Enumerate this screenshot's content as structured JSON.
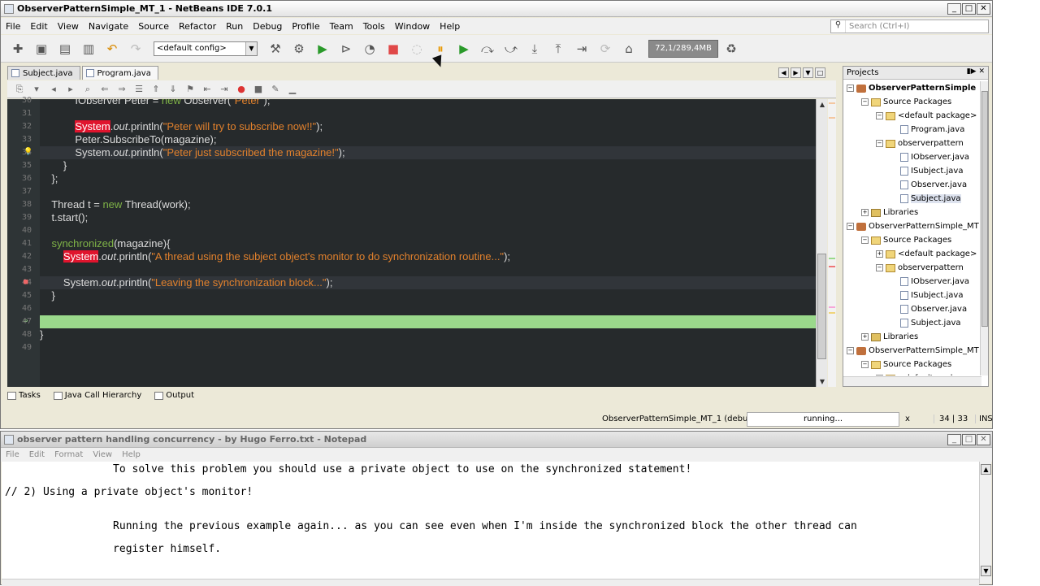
{
  "netbeans": {
    "title": "ObserverPatternSimple_MT_1 - NetBeans IDE 7.0.1",
    "menu": [
      "File",
      "Edit",
      "View",
      "Navigate",
      "Source",
      "Refactor",
      "Run",
      "Debug",
      "Profile",
      "Team",
      "Tools",
      "Window",
      "Help"
    ],
    "search_placeholder": "Search (Ctrl+I)",
    "config": "<default config>",
    "memory": "72,1/289,4MB",
    "tabs": [
      "Subject.java",
      "Program.java"
    ],
    "code_lines": [
      {
        "n": "30",
        "parts": [
          {
            "t": "            IObserver Peter = "
          },
          {
            "t": "new",
            "c": "kw"
          },
          {
            "t": " Observer("
          },
          {
            "t": "\"Peter\"",
            "c": "str"
          },
          {
            "t": ");"
          }
        ]
      },
      {
        "n": "31",
        "parts": []
      },
      {
        "n": "32",
        "parts": [
          {
            "t": "            "
          },
          {
            "t": "System",
            "c": "err"
          },
          {
            "t": "."
          },
          {
            "t": "out",
            "c": "it"
          },
          {
            "t": ".println("
          },
          {
            "t": "\"Peter will try to subscribe now!!\"",
            "c": "str"
          },
          {
            "t": ");"
          }
        ]
      },
      {
        "n": "33",
        "parts": [
          {
            "t": "            Peter.SubscribeTo(magazine);"
          }
        ]
      },
      {
        "n": "34",
        "parts": [
          {
            "t": "            System."
          },
          {
            "t": "out",
            "c": "it"
          },
          {
            "t": ".println("
          },
          {
            "t": "\"Peter just subscribed the magazine!\"",
            "c": "str"
          },
          {
            "t": ");"
          }
        ]
      },
      {
        "n": "35",
        "parts": [
          {
            "t": "        }"
          }
        ]
      },
      {
        "n": "36",
        "parts": [
          {
            "t": "    };"
          }
        ]
      },
      {
        "n": "37",
        "parts": []
      },
      {
        "n": "38",
        "parts": [
          {
            "t": "    Thread t = "
          },
          {
            "t": "new",
            "c": "kw"
          },
          {
            "t": " Thread(work);"
          }
        ]
      },
      {
        "n": "39",
        "parts": [
          {
            "t": "    t.start();"
          }
        ]
      },
      {
        "n": "40",
        "parts": []
      },
      {
        "n": "41",
        "parts": [
          {
            "t": "    "
          },
          {
            "t": "synchronized",
            "c": "kw"
          },
          {
            "t": "(magazine){"
          }
        ]
      },
      {
        "n": "42",
        "parts": [
          {
            "t": "        "
          },
          {
            "t": "System",
            "c": "err"
          },
          {
            "t": "."
          },
          {
            "t": "out",
            "c": "it"
          },
          {
            "t": ".println("
          },
          {
            "t": "\"A thread using the subject object's monitor to do synchronization routine...\"",
            "c": "str"
          },
          {
            "t": ");"
          }
        ]
      },
      {
        "n": "43",
        "parts": []
      },
      {
        "n": "44",
        "parts": [
          {
            "t": "        System."
          },
          {
            "t": "out",
            "c": "it"
          },
          {
            "t": ".println("
          },
          {
            "t": "\"Leaving the synchronization block...\"",
            "c": "str"
          },
          {
            "t": ");"
          }
        ]
      },
      {
        "n": "45",
        "parts": [
          {
            "t": "    }"
          }
        ]
      },
      {
        "n": "46",
        "parts": []
      },
      {
        "n": "47",
        "parts": []
      },
      {
        "n": "48",
        "parts": [
          {
            "t": "}"
          }
        ]
      },
      {
        "n": "49",
        "parts": []
      }
    ],
    "projects_title": "Projects",
    "tree": [
      {
        "label": "ObserverPatternSimple",
        "lvl": 0,
        "icon": "proj",
        "tog": "−",
        "bold": true
      },
      {
        "label": "Source Packages",
        "lvl": 1,
        "icon": "pkg",
        "tog": "−"
      },
      {
        "label": "<default package>",
        "lvl": 2,
        "icon": "pkg",
        "tog": "−"
      },
      {
        "label": "Program.java",
        "lvl": 3,
        "icon": "file"
      },
      {
        "label": "observerpattern",
        "lvl": 2,
        "icon": "pkg",
        "tog": "−"
      },
      {
        "label": "IObserver.java",
        "lvl": 3,
        "icon": "file"
      },
      {
        "label": "ISubject.java",
        "lvl": 3,
        "icon": "file"
      },
      {
        "label": "Observer.java",
        "lvl": 3,
        "icon": "file"
      },
      {
        "label": "Subject.java",
        "lvl": 3,
        "icon": "file",
        "sel": true
      },
      {
        "label": "Libraries",
        "lvl": 1,
        "icon": "lib",
        "tog": "+"
      },
      {
        "label": "ObserverPatternSimple_MT",
        "lvl": 0,
        "icon": "proj",
        "tog": "−"
      },
      {
        "label": "Source Packages",
        "lvl": 1,
        "icon": "pkg",
        "tog": "−"
      },
      {
        "label": "<default package>",
        "lvl": 2,
        "icon": "pkg",
        "tog": "+"
      },
      {
        "label": "observerpattern",
        "lvl": 2,
        "icon": "pkg",
        "tog": "−"
      },
      {
        "label": "IObserver.java",
        "lvl": 3,
        "icon": "file"
      },
      {
        "label": "ISubject.java",
        "lvl": 3,
        "icon": "file"
      },
      {
        "label": "Observer.java",
        "lvl": 3,
        "icon": "file"
      },
      {
        "label": "Subject.java",
        "lvl": 3,
        "icon": "file"
      },
      {
        "label": "Libraries",
        "lvl": 1,
        "icon": "lib",
        "tog": "+"
      },
      {
        "label": "ObserverPatternSimple_MT",
        "lvl": 0,
        "icon": "proj",
        "tog": "−"
      },
      {
        "label": "Source Packages",
        "lvl": 1,
        "icon": "pkg",
        "tog": "−"
      },
      {
        "label": "<default package>",
        "lvl": 2,
        "icon": "pkg",
        "tog": "+"
      }
    ],
    "bottom_tabs": [
      "Tasks",
      "Java Call Hierarchy",
      "Output"
    ],
    "status_project": "ObserverPatternSimple_MT_1 (debug)",
    "status_progress": "running...",
    "status_cancel": "x",
    "status_pos": "34 | 33",
    "status_mode": "INS"
  },
  "notepad": {
    "title": "observer pattern handling concurrency - by Hugo Ferro.txt - Notepad",
    "menu": [
      "File",
      "Edit",
      "Format",
      "View",
      "Help"
    ],
    "lines": [
      "                 To solve this problem you should use a private object to use on the synchronized statement!",
      "// 2) Using a private object's monitor!",
      "",
      "                 Running the previous example again... as you can see even when I'm inside the synchronized block the other thread can",
      "                 register himself."
    ]
  }
}
